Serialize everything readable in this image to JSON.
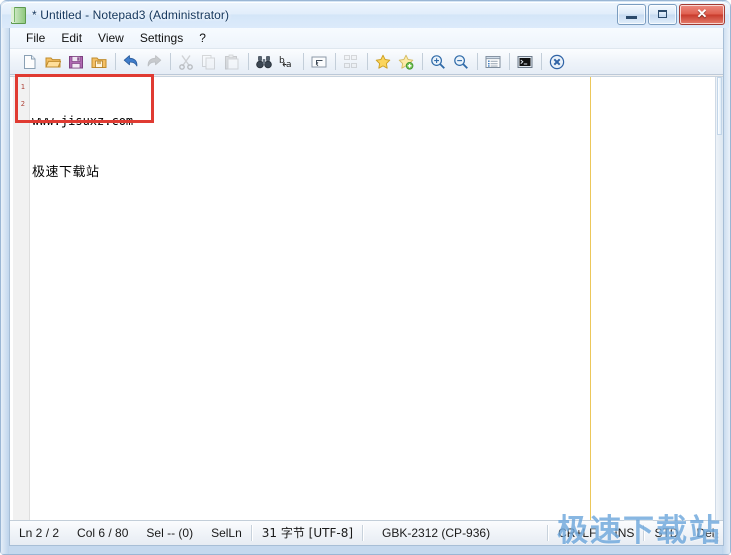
{
  "window": {
    "title": "* Untitled - Notepad3 (Administrator)",
    "app_icon": "notepad-icon",
    "buttons": {
      "minimize": "minimize-button",
      "maximize": "maximize-button",
      "close_glyph": "✕"
    }
  },
  "menubar": {
    "items": [
      {
        "label": "File",
        "name": "menu-file"
      },
      {
        "label": "Edit",
        "name": "menu-edit"
      },
      {
        "label": "View",
        "name": "menu-view"
      },
      {
        "label": "Settings",
        "name": "menu-settings"
      },
      {
        "label": "?",
        "name": "menu-help"
      }
    ]
  },
  "toolbar": {
    "items": [
      {
        "name": "new-file-icon",
        "title": "New",
        "enabled": true
      },
      {
        "name": "open-file-icon",
        "title": "Open",
        "enabled": true
      },
      {
        "name": "save-icon",
        "title": "Save",
        "enabled": true
      },
      {
        "name": "save-as-icon",
        "title": "Save As",
        "enabled": true
      },
      {
        "name": "separator",
        "title": "",
        "enabled": true
      },
      {
        "name": "undo-icon",
        "title": "Undo",
        "enabled": true
      },
      {
        "name": "redo-icon",
        "title": "Redo",
        "enabled": false
      },
      {
        "name": "separator",
        "title": "",
        "enabled": true
      },
      {
        "name": "cut-icon",
        "title": "Cut",
        "enabled": false
      },
      {
        "name": "copy-icon",
        "title": "Copy",
        "enabled": false
      },
      {
        "name": "paste-icon",
        "title": "Paste",
        "enabled": false
      },
      {
        "name": "separator",
        "title": "",
        "enabled": true
      },
      {
        "name": "find-icon",
        "title": "Find",
        "enabled": true
      },
      {
        "name": "replace-icon",
        "title": "Replace",
        "enabled": true
      },
      {
        "name": "separator",
        "title": "",
        "enabled": true
      },
      {
        "name": "word-wrap-icon",
        "title": "Word Wrap",
        "enabled": true
      },
      {
        "name": "separator",
        "title": "",
        "enabled": true
      },
      {
        "name": "align-icon",
        "title": "Align",
        "enabled": false
      },
      {
        "name": "separator",
        "title": "",
        "enabled": true
      },
      {
        "name": "favorites-icon",
        "title": "Favorites",
        "enabled": true
      },
      {
        "name": "add-favorite-icon",
        "title": "Add to Favorites",
        "enabled": true
      },
      {
        "name": "separator",
        "title": "",
        "enabled": true
      },
      {
        "name": "zoom-in-icon",
        "title": "Zoom In",
        "enabled": true
      },
      {
        "name": "zoom-out-icon",
        "title": "Zoom Out",
        "enabled": true
      },
      {
        "name": "separator",
        "title": "",
        "enabled": true
      },
      {
        "name": "scheme-icon",
        "title": "Schemes",
        "enabled": true
      },
      {
        "name": "separator",
        "title": "",
        "enabled": true
      },
      {
        "name": "console-icon",
        "title": "Open Console",
        "enabled": true
      },
      {
        "name": "separator",
        "title": "",
        "enabled": true
      },
      {
        "name": "exit-icon",
        "title": "Exit",
        "enabled": true
      }
    ]
  },
  "editor": {
    "lines": [
      {
        "number": "1",
        "text": "www.jisuxz.com",
        "cjk": false
      },
      {
        "number": "2",
        "text": "极速下载站",
        "cjk": true
      }
    ],
    "long_line_marker_column": "80",
    "line_number_color": "#b0443a",
    "marker_color": "#ecc75a"
  },
  "annotation": {
    "name": "red-highlight-box",
    "color": "#e03b32"
  },
  "statusbar": {
    "fields": [
      {
        "name": "status-line",
        "text": "Ln 2 / 2",
        "cjk": false
      },
      {
        "name": "status-column",
        "text": "Col 6 / 80",
        "cjk": false
      },
      {
        "name": "status-selection",
        "text": "Sel -- (0)",
        "cjk": false
      },
      {
        "name": "status-selection-lines",
        "text": "SelLn",
        "cjk": false
      },
      {
        "name": "status-bytes",
        "text": "31 字节 [UTF-8]",
        "cjk": true
      },
      {
        "name": "status-encoding",
        "text": "GBK-2312 (CP-936)",
        "cjk": false
      },
      {
        "name": "status-eol",
        "text": "CR+LF",
        "cjk": false
      },
      {
        "name": "status-insert-mode",
        "text": "INS",
        "cjk": false
      },
      {
        "name": "status-doc-mode",
        "text": "STD",
        "cjk": false
      },
      {
        "name": "status-del-mode",
        "text": "Del",
        "cjk": false
      }
    ]
  },
  "watermark": {
    "text": "极速下载站",
    "color": "#6fa8dc"
  }
}
